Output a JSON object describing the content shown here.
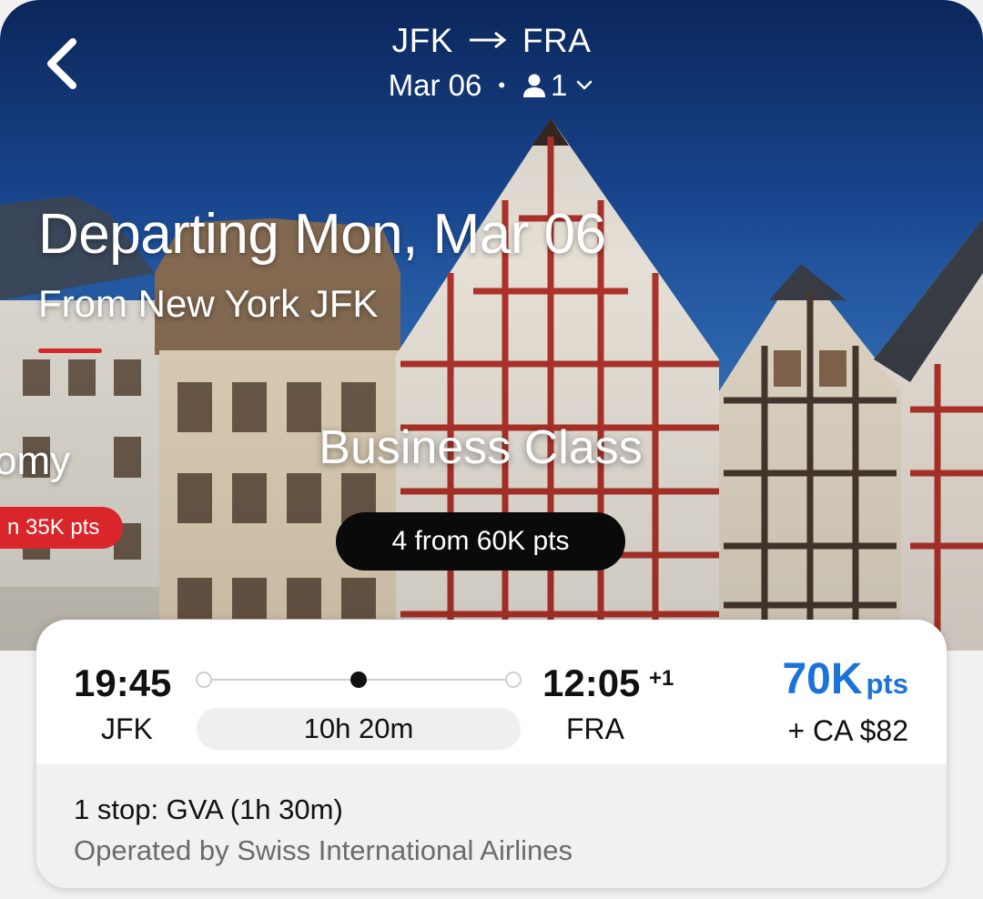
{
  "header": {
    "origin": "JFK",
    "destination": "FRA",
    "date": "Mar 06",
    "passengers": "1"
  },
  "hero": {
    "title": "Departing Mon, Mar 06",
    "subtitle": "From New York JFK",
    "cabins": [
      {
        "label": "omy",
        "price_label": "n 35K pts",
        "selected": false
      },
      {
        "label": "Business Class",
        "price_label": "4 from 60K pts",
        "selected": true
      }
    ]
  },
  "flight": {
    "departure_time": "19:45",
    "departure_code": "JFK",
    "arrival_time": "12:05",
    "arrival_day_offset": "+1",
    "arrival_code": "FRA",
    "duration": "10h 20m",
    "points_amount": "70K",
    "points_unit": "pts",
    "fee": "+ CA $82",
    "stops": "1 stop: GVA (1h 30m)",
    "operated_by": "Operated by Swiss International Airlines"
  },
  "colors": {
    "accent_red": "#d8262b",
    "points_blue": "#1a73d9"
  },
  "icons": [
    "chevron-left-icon",
    "arrow-right-icon",
    "person-icon",
    "chevron-down-icon"
  ]
}
